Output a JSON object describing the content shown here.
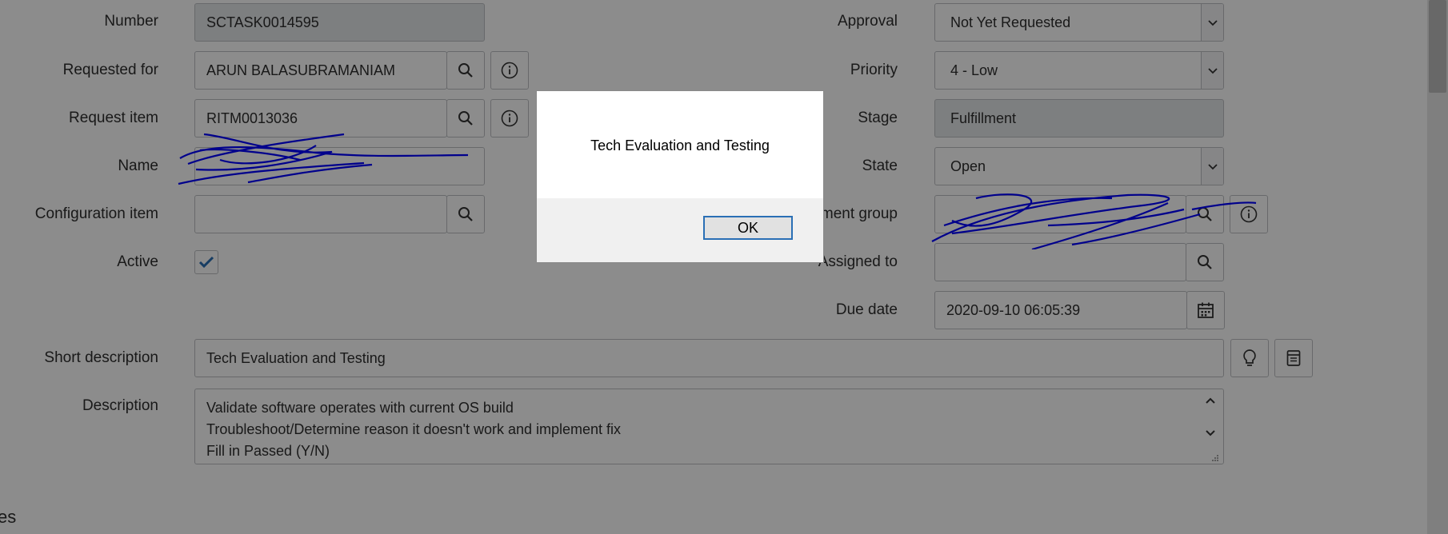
{
  "form": {
    "left": {
      "number": {
        "label": "Number",
        "value": "SCTASK0014595"
      },
      "requested_for": {
        "label": "Requested for",
        "value": "ARUN BALASUBRAMANIAM"
      },
      "request_item": {
        "label": "Request item",
        "value": "RITM0013036"
      },
      "name": {
        "label": "Name",
        "value": ""
      },
      "configuration_item": {
        "label": "Configuration item",
        "value": ""
      },
      "active": {
        "label": "Active",
        "checked": true
      }
    },
    "right": {
      "approval": {
        "label": "Approval",
        "value": "Not Yet Requested"
      },
      "priority": {
        "label": "Priority",
        "value": "4 - Low"
      },
      "stage": {
        "label": "Stage",
        "value": "Fulfillment"
      },
      "state": {
        "label": "State",
        "value": "Open"
      },
      "assignment_group": {
        "label": "ment group",
        "value": ""
      },
      "assigned_to": {
        "label": "Assigned to",
        "value": ""
      },
      "due_date": {
        "label": "Due date",
        "value": "2020-09-10 06:05:39"
      }
    },
    "short_description": {
      "label": "Short description",
      "value": "Tech Evaluation and Testing"
    },
    "description": {
      "label": "Description",
      "lines": [
        "Validate software operates with current OS build",
        "Troubleshoot/Determine reason it doesn't work and implement fix",
        "Fill in Passed (Y/N)"
      ]
    },
    "section_fragment": "es"
  },
  "dialog": {
    "message": "Tech Evaluation and Testing",
    "ok_label": "OK"
  },
  "colors": {
    "overlay": "#000000",
    "scribble": "#0000ff",
    "ok_border": "#2a6fb5"
  }
}
